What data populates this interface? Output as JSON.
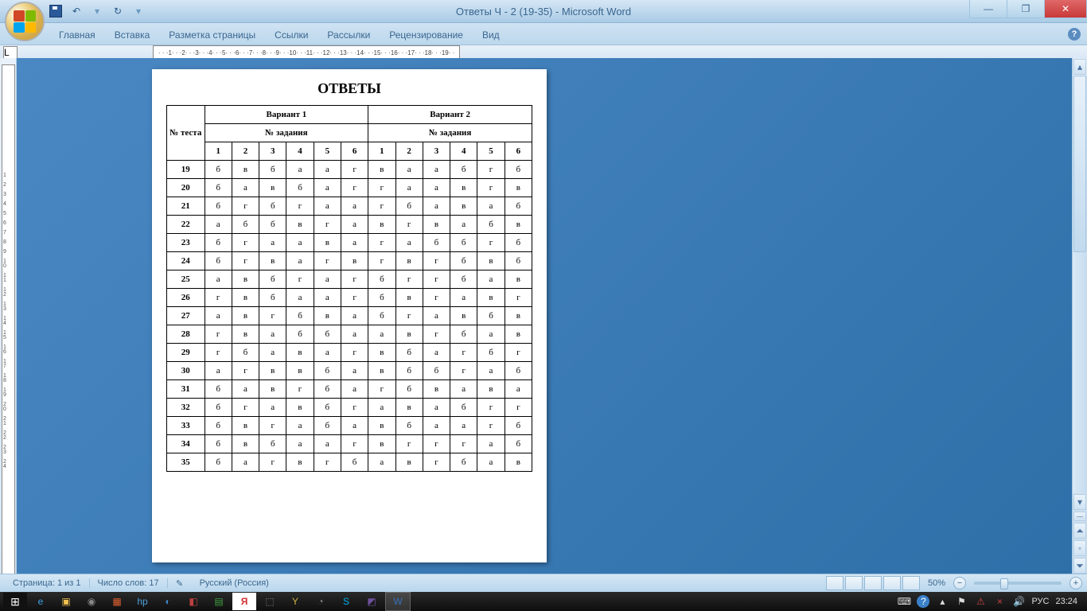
{
  "title": "Ответы Ч - 2 (19-35) - Microsoft Word",
  "tabs": [
    "Главная",
    "Вставка",
    "Разметка страницы",
    "Ссылки",
    "Рассылки",
    "Рецензирование",
    "Вид"
  ],
  "hruler": "· · ·1· · ·2· · ·3· · ·4· · ·5· · ·6· · ·7· · ·8· · ·9· · ·10· · ·11· · ·12· · ·13· · ·14· · ·15· · ·16· · ·17· · ·18· · ·19· ·",
  "vruler": "1 2 3 4 5 6 7 8 9 10 11 12 13 14 15 16 17 18 19 20 21 22 23 24",
  "doc": {
    "heading": "ОТВЕТЫ",
    "corner": "№ теста",
    "variants": [
      "Вариант 1",
      "Вариант 2"
    ],
    "subhead": "№ задания",
    "cols": [
      "1",
      "2",
      "3",
      "4",
      "5",
      "6"
    ],
    "rows": [
      {
        "n": "19",
        "v1": [
          "б",
          "в",
          "б",
          "а",
          "а",
          "г"
        ],
        "v2": [
          "в",
          "а",
          "а",
          "б",
          "г",
          "б"
        ]
      },
      {
        "n": "20",
        "v1": [
          "б",
          "а",
          "в",
          "б",
          "а",
          "г"
        ],
        "v2": [
          "г",
          "а",
          "а",
          "в",
          "г",
          "в"
        ]
      },
      {
        "n": "21",
        "v1": [
          "б",
          "г",
          "б",
          "г",
          "а",
          "а"
        ],
        "v2": [
          "г",
          "б",
          "а",
          "в",
          "а",
          "б"
        ]
      },
      {
        "n": "22",
        "v1": [
          "а",
          "б",
          "б",
          "в",
          "г",
          "а"
        ],
        "v2": [
          "в",
          "г",
          "в",
          "а",
          "б",
          "в"
        ]
      },
      {
        "n": "23",
        "v1": [
          "б",
          "г",
          "а",
          "а",
          "в",
          "а"
        ],
        "v2": [
          "г",
          "а",
          "б",
          "б",
          "г",
          "б"
        ]
      },
      {
        "n": "24",
        "v1": [
          "б",
          "г",
          "в",
          "а",
          "г",
          "в"
        ],
        "v2": [
          "г",
          "в",
          "г",
          "б",
          "в",
          "б"
        ]
      },
      {
        "n": "25",
        "v1": [
          "а",
          "в",
          "б",
          "г",
          "а",
          "г"
        ],
        "v2": [
          "б",
          "г",
          "г",
          "б",
          "а",
          "в"
        ]
      },
      {
        "n": "26",
        "v1": [
          "г",
          "в",
          "б",
          "а",
          "а",
          "г"
        ],
        "v2": [
          "б",
          "в",
          "г",
          "а",
          "в",
          "г"
        ]
      },
      {
        "n": "27",
        "v1": [
          "а",
          "в",
          "г",
          "б",
          "в",
          "а"
        ],
        "v2": [
          "б",
          "г",
          "а",
          "в",
          "б",
          "в"
        ]
      },
      {
        "n": "28",
        "v1": [
          "г",
          "в",
          "а",
          "б",
          "б",
          "а"
        ],
        "v2": [
          "а",
          "в",
          "г",
          "б",
          "а",
          "в"
        ]
      },
      {
        "n": "29",
        "v1": [
          "г",
          "б",
          "а",
          "в",
          "а",
          "г"
        ],
        "v2": [
          "в",
          "б",
          "а",
          "г",
          "б",
          "г"
        ]
      },
      {
        "n": "30",
        "v1": [
          "а",
          "г",
          "в",
          "в",
          "б",
          "а"
        ],
        "v2": [
          "в",
          "б",
          "б",
          "г",
          "а",
          "б"
        ]
      },
      {
        "n": "31",
        "v1": [
          "б",
          "а",
          "в",
          "г",
          "б",
          "а"
        ],
        "v2": [
          "г",
          "б",
          "в",
          "а",
          "в",
          "а"
        ]
      },
      {
        "n": "32",
        "v1": [
          "б",
          "г",
          "а",
          "в",
          "б",
          "г"
        ],
        "v2": [
          "а",
          "в",
          "а",
          "б",
          "г",
          "г"
        ]
      },
      {
        "n": "33",
        "v1": [
          "б",
          "в",
          "г",
          "а",
          "б",
          "а"
        ],
        "v2": [
          "в",
          "б",
          "а",
          "а",
          "г",
          "б"
        ]
      },
      {
        "n": "34",
        "v1": [
          "б",
          "в",
          "б",
          "а",
          "а",
          "г"
        ],
        "v2": [
          "в",
          "г",
          "г",
          "г",
          "а",
          "б"
        ]
      },
      {
        "n": "35",
        "v1": [
          "б",
          "а",
          "г",
          "в",
          "г",
          "б"
        ],
        "v2": [
          "а",
          "в",
          "г",
          "б",
          "а",
          "в"
        ]
      }
    ]
  },
  "status": {
    "page": "Страница: 1 из 1",
    "words": "Число слов: 17",
    "lang": "Русский (Россия)",
    "zoom": "50%"
  },
  "tray": {
    "kbd": "РУС",
    "time": "23:24"
  }
}
